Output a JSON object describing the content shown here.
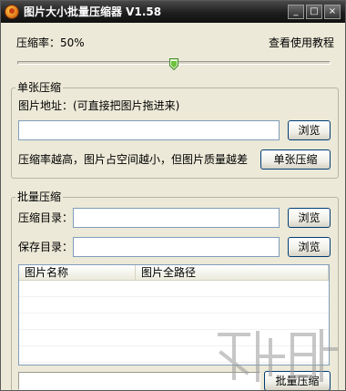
{
  "window": {
    "title": "图片大小批量压缩器 V1.58",
    "controls": [
      "_",
      "□",
      "×"
    ]
  },
  "compression": {
    "rate_label": "压缩率：50%",
    "rate_value_percent": 50,
    "help_link": "查看使用教程"
  },
  "single": {
    "group_title": "单张压缩",
    "path_label": "图片地址：(可直接把图片拖进来)",
    "path_value": "",
    "browse_label": "浏览",
    "hint": "压缩率越高，图片占空间越小，但图片质量越差",
    "compress_button": "单张压缩"
  },
  "batch": {
    "group_title": "批量压缩",
    "dir_label": "压缩目录：",
    "dir_value": "",
    "dir_browse": "浏览",
    "save_label": "保存目录：",
    "save_value": "",
    "save_browse": "浏览",
    "list_columns": [
      "图片名称",
      "图片全路径"
    ],
    "compress_button": "批量压缩"
  },
  "progress": {
    "value_percent": 0
  },
  "colors": {
    "title_bar": "#1e1e1e",
    "face": "#ece9d8",
    "button_border": "#003c74"
  }
}
